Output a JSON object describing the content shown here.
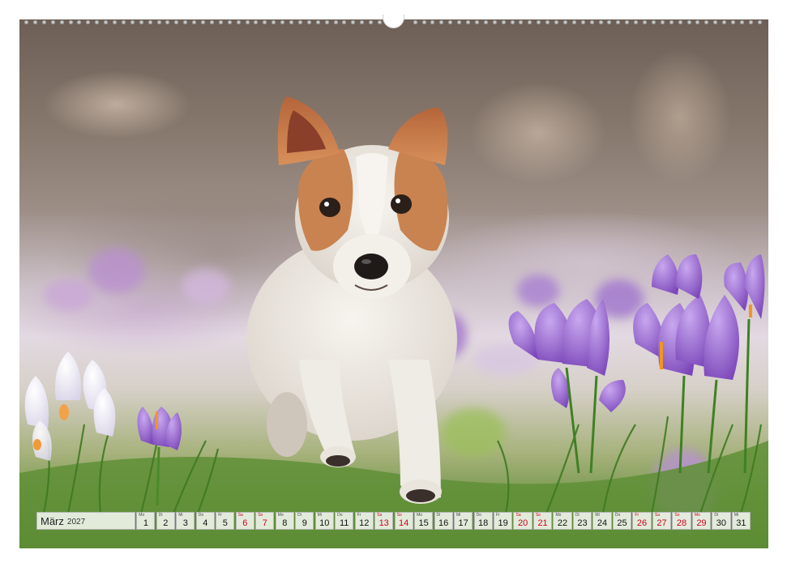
{
  "calendar": {
    "month": "März",
    "year": "2027",
    "days": [
      {
        "wd": "Mo",
        "n": "1",
        "weekend": false
      },
      {
        "wd": "Di",
        "n": "2",
        "weekend": false
      },
      {
        "wd": "Mi",
        "n": "3",
        "weekend": false
      },
      {
        "wd": "Do",
        "n": "4",
        "weekend": false
      },
      {
        "wd": "Fr",
        "n": "5",
        "weekend": false
      },
      {
        "wd": "Sa",
        "n": "6",
        "weekend": true
      },
      {
        "wd": "So",
        "n": "7",
        "weekend": true
      },
      {
        "wd": "Mo",
        "n": "8",
        "weekend": false
      },
      {
        "wd": "Di",
        "n": "9",
        "weekend": false
      },
      {
        "wd": "Mi",
        "n": "10",
        "weekend": false
      },
      {
        "wd": "Do",
        "n": "11",
        "weekend": false
      },
      {
        "wd": "Fr",
        "n": "12",
        "weekend": false
      },
      {
        "wd": "Sa",
        "n": "13",
        "weekend": true
      },
      {
        "wd": "So",
        "n": "14",
        "weekend": true
      },
      {
        "wd": "Mo",
        "n": "15",
        "weekend": false
      },
      {
        "wd": "Di",
        "n": "16",
        "weekend": false
      },
      {
        "wd": "Mi",
        "n": "17",
        "weekend": false
      },
      {
        "wd": "Do",
        "n": "18",
        "weekend": false
      },
      {
        "wd": "Fr",
        "n": "19",
        "weekend": false
      },
      {
        "wd": "Sa",
        "n": "20",
        "weekend": true
      },
      {
        "wd": "So",
        "n": "21",
        "weekend": true
      },
      {
        "wd": "Mo",
        "n": "22",
        "weekend": false
      },
      {
        "wd": "Di",
        "n": "23",
        "weekend": false
      },
      {
        "wd": "Mi",
        "n": "24",
        "weekend": false
      },
      {
        "wd": "Do",
        "n": "25",
        "weekend": false
      },
      {
        "wd": "Fr",
        "n": "26",
        "weekend": true
      },
      {
        "wd": "Sa",
        "n": "27",
        "weekend": true
      },
      {
        "wd": "So",
        "n": "28",
        "weekend": true
      },
      {
        "wd": "Mo",
        "n": "29",
        "weekend": true
      },
      {
        "wd": "Di",
        "n": "30",
        "weekend": false
      },
      {
        "wd": "Mi",
        "n": "31",
        "weekend": false
      }
    ]
  },
  "colors": {
    "weekend_text": "#d0021b",
    "crocus_purple": "#8e5fc7",
    "dog_fur_brown": "#c07a45"
  },
  "image": {
    "subject": "dog-photo"
  }
}
